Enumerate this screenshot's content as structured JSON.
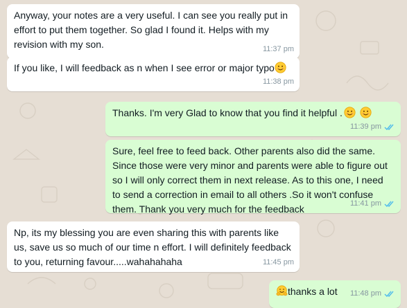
{
  "chat": {
    "colors": {
      "incoming_bubble": "#ffffff",
      "outgoing_bubble": "#d9fdd3",
      "wallpaper": "#e6ded4",
      "read_ticks": "#53bdeb",
      "timestamp": "#8696a0"
    },
    "messages": [
      {
        "direction": "incoming",
        "text": "Anyway, your notes are a very useful. I can see you really put in effort to put them together. So glad I found it. Helps with my revision with my son.",
        "time": "11:37 pm"
      },
      {
        "direction": "incoming",
        "text": "If you like, I will feedback as n when I see error or major typo",
        "emoji": "smiling-face-emoji",
        "time": "11:38 pm"
      },
      {
        "direction": "outgoing",
        "text": "Thanks. I'm very Glad to know that  you find it helpful .",
        "emoji": "smiling-face-emoji",
        "time": "11:39 pm",
        "status": "read"
      },
      {
        "direction": "outgoing",
        "text": "Sure, feel free to feed back. Other parents also did the same. Since those were very minor and parents were able to figure out so I will only correct them in next release. As to this one, I need to send a correction in email to all others .So it won't confuse them. Thank you very much for the feedback",
        "time": "11:41 pm",
        "status": "read"
      },
      {
        "direction": "incoming",
        "text": "Np, its my blessing you are even sharing this with parents like us, save us so much of our time n effort. I will definitely feedback to you, returning favour.....wahahahaha",
        "time": "11:45 pm"
      },
      {
        "direction": "outgoing",
        "text": "thanks a lot",
        "emoji": "hugging-face-emoji",
        "time": "11:48 pm",
        "status": "read"
      }
    ]
  }
}
